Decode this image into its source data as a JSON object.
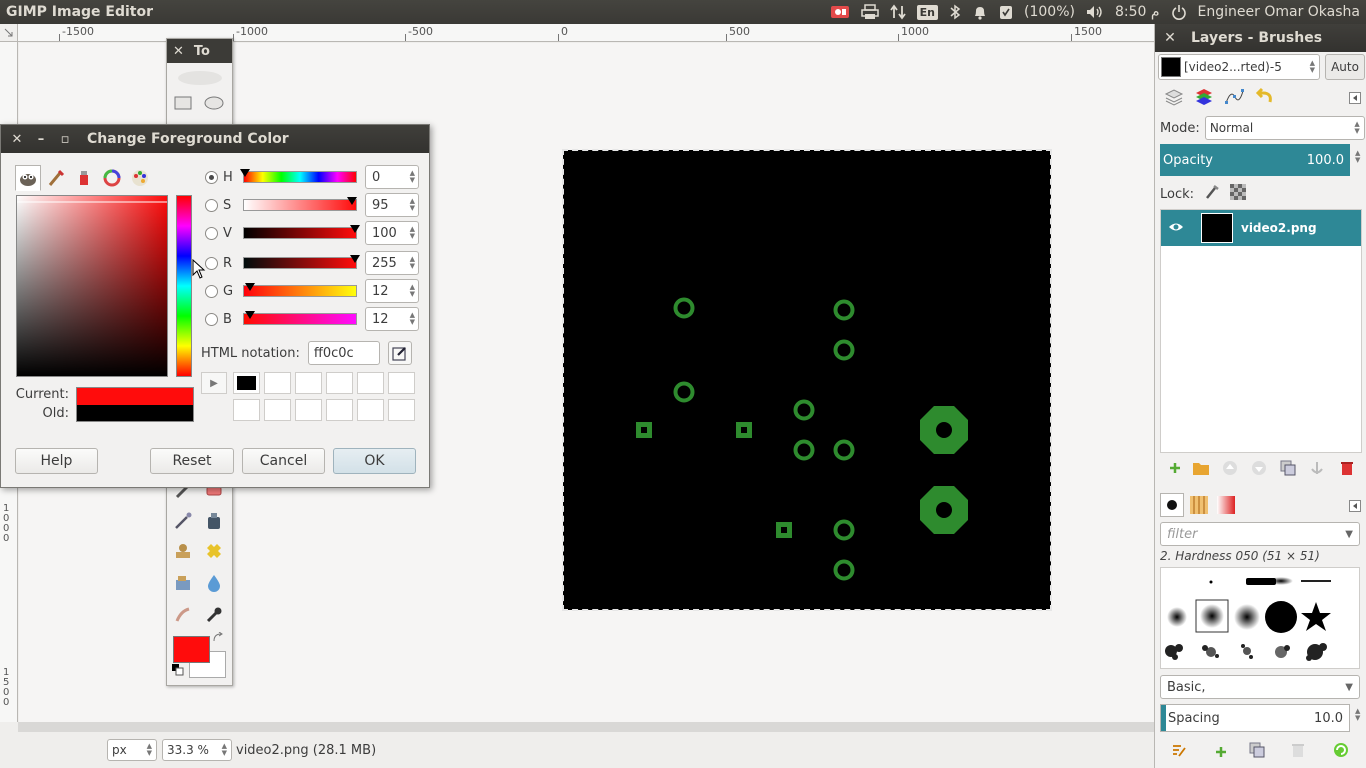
{
  "top_panel": {
    "app_title": "GIMP Image Editor",
    "battery": "(100%)",
    "keyboard_layout": "En",
    "clock": "8:50 م",
    "user": "Engineer Omar Okasha"
  },
  "rulers": {
    "top_labels": [
      "-1500",
      "-1000",
      "-500",
      "0",
      "500",
      "1000",
      "1500"
    ],
    "left_labels": [
      "1000",
      "1500"
    ]
  },
  "toolbox": {
    "title": "To",
    "fg_color": "#ff0c0c",
    "bg_color": "#ffffff"
  },
  "status_bar": {
    "unit": "px",
    "zoom": "33.3 %",
    "status_text": "video2.png (28.1 MB)"
  },
  "dialog": {
    "title": "Change Foreground Color",
    "sliders": [
      {
        "label": "H",
        "value": "0",
        "selected": true
      },
      {
        "label": "S",
        "value": "95",
        "selected": false
      },
      {
        "label": "V",
        "value": "100",
        "selected": false
      },
      {
        "label": "R",
        "value": "255",
        "selected": false
      },
      {
        "label": "G",
        "value": "12",
        "selected": false
      },
      {
        "label": "B",
        "value": "12",
        "selected": false
      }
    ],
    "html_label": "HTML notation:",
    "html_value": "ff0c0c",
    "current_label": "Current:",
    "old_label": "Old:",
    "current_color": "#ff0c0c",
    "old_color": "#000000",
    "buttons": {
      "help": "Help",
      "reset": "Reset",
      "cancel": "Cancel",
      "ok": "OK"
    }
  },
  "dock": {
    "title": "Layers - Brushes",
    "image_combo": "[video2...rted)-5",
    "auto_button": "Auto",
    "mode_label": "Mode:",
    "mode_value": "Normal",
    "opacity_label": "Opacity",
    "opacity_value": "100.0",
    "lock_label": "Lock:",
    "layer_name": "video2.png",
    "filter_placeholder": "filter",
    "brush_name": "2. Hardness 050 (51 × 51)",
    "brush_set": "Basic,",
    "spacing_label": "Spacing",
    "spacing_value": "10.0"
  },
  "colors": {
    "accent": "#2e8896",
    "pcb_green": "#2e8b2e",
    "titlebar": "#3c3b37"
  }
}
